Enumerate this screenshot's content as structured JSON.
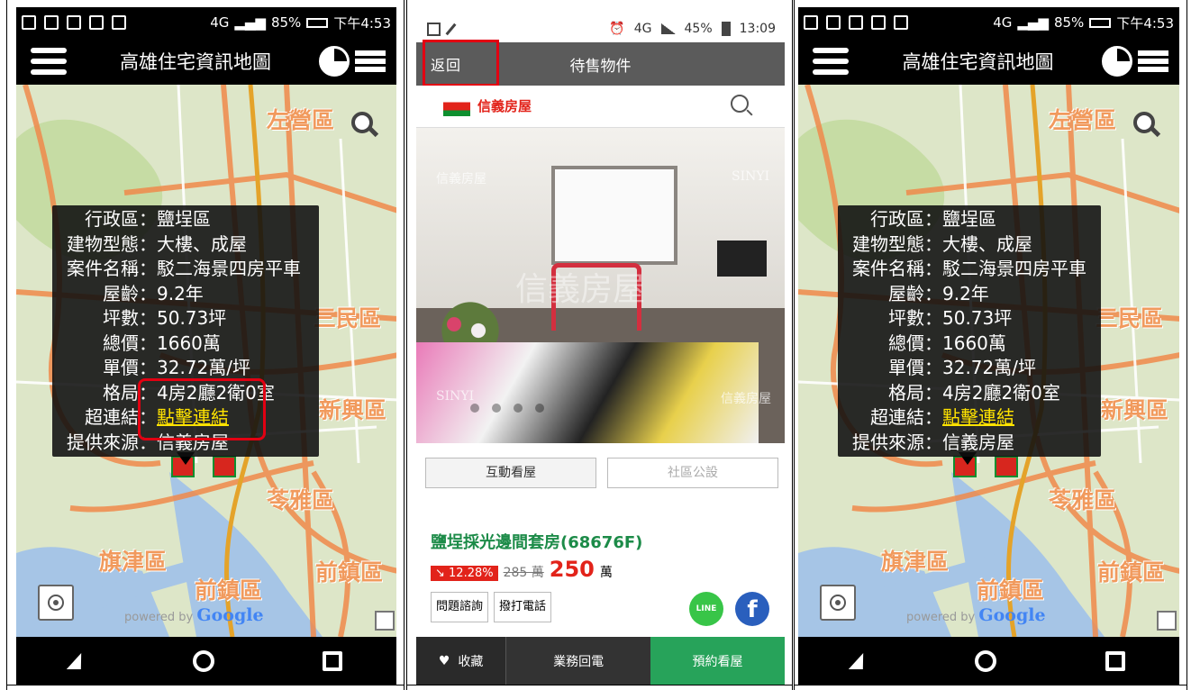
{
  "map_app": {
    "status_bar": {
      "network": "4G",
      "battery": "85%",
      "time": "下午4:53"
    },
    "title": "高雄住宅資訊地圖",
    "districts": [
      "左營區",
      "三民區",
      "新興區",
      "苓雅區",
      "旗津區",
      "前鎮區"
    ],
    "powered_prefix": "powered by",
    "powered_brand": "Google",
    "info": [
      {
        "label": "行政區：",
        "value": "鹽埕區"
      },
      {
        "label": "建物型態：",
        "value": "大樓、成屋"
      },
      {
        "label": "案件名稱：",
        "value": "駁二海景四房平車"
      },
      {
        "label": "屋齡：",
        "value": "9.2年"
      },
      {
        "label": "坪數：",
        "value": "50.73坪"
      },
      {
        "label": "總價：",
        "value": "1660萬"
      },
      {
        "label": "單價：",
        "value": "32.72萬/坪"
      },
      {
        "label": "格局：",
        "value": "4房2廳2衛0室"
      },
      {
        "label": "超連結：",
        "value": "點擊連結"
      },
      {
        "label": "提供來源：",
        "value": "信義房屋"
      }
    ]
  },
  "listing_app": {
    "status_bar": {
      "network": "4G",
      "battery": "45%",
      "time": "13:09"
    },
    "back_label": "返回",
    "title": "待售物件",
    "brand": "信義房屋",
    "watermarks": {
      "tl": "信義房屋",
      "tr": "SINYI",
      "center": "信義房屋",
      "bl": "SINYI",
      "br": "信義房屋"
    },
    "tab_interactive": "互動看屋",
    "tab_community": "社區公設",
    "property_title": "鹽埕採光邊間套房(68676F)",
    "discount": "12.28%",
    "old_price": "285 萬",
    "new_price": "250",
    "unit": "萬",
    "btn_question": "問題諮詢",
    "btn_call": "撥打電話",
    "line_label": "LINE",
    "fb_label": "f",
    "bottom": {
      "favorite": "收藏",
      "callback": "業務回電",
      "book": "預約看屋"
    }
  },
  "colors": {
    "highlight": "#e20012",
    "link": "#ffe300",
    "sinyi_green": "#1c8b48",
    "sinyi_red": "#e2231a",
    "district": "#f19a5d"
  }
}
